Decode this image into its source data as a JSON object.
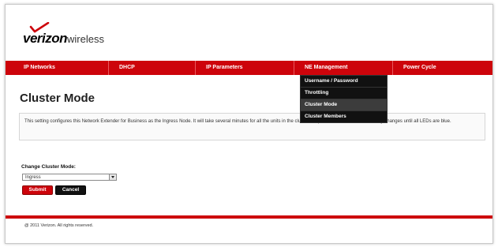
{
  "brand": {
    "name": "verizon",
    "suffix": "wireless",
    "accent": "#cd040b"
  },
  "nav": {
    "items": [
      {
        "label": "IP Networks"
      },
      {
        "label": "DHCP"
      },
      {
        "label": "IP Parameters"
      },
      {
        "label": "NE Management"
      },
      {
        "label": "Power Cycle"
      }
    ]
  },
  "ne_menu": {
    "items": [
      {
        "label": "Username / Password"
      },
      {
        "label": "Throttling"
      },
      {
        "label": "Cluster Mode"
      },
      {
        "label": "Cluster Members"
      }
    ],
    "selected": "Cluster Mode"
  },
  "page": {
    "title": "Cluster Mode",
    "info": "This setting configures this Network Extender for Business as the Ingress Node. It will take several minutes for all the units in the cluster to update. Please do not make any changes until all LEDs are blue."
  },
  "form": {
    "label": "Change Cluster Mode:",
    "selected_value": "Ingress",
    "submit_label": "Submit",
    "cancel_label": "Cancel"
  },
  "footer": {
    "copyright": "@ 2011 Verizon. All rights reserved."
  }
}
